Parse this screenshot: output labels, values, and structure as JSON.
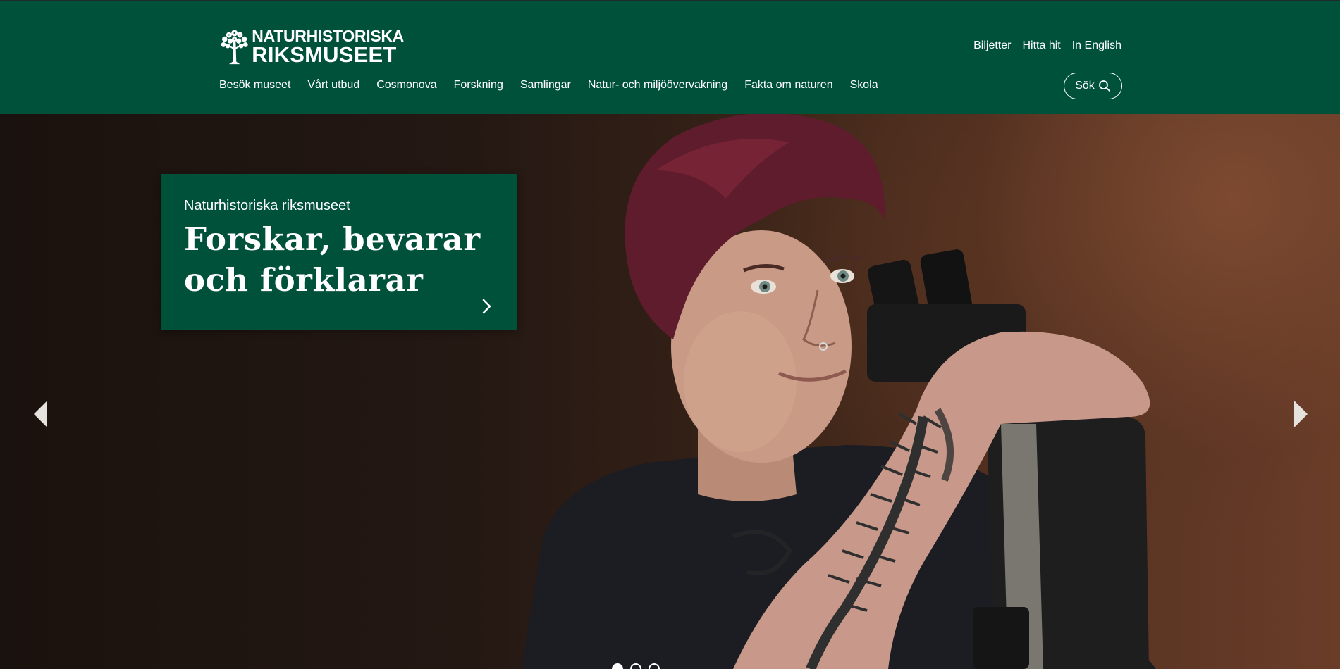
{
  "brand": {
    "line1": "NATURHISTORISKA",
    "line2": "RIKSMUSEET",
    "accent_color": "#00513a"
  },
  "top_links": [
    "Biljetter",
    "Hitta hit",
    "In English"
  ],
  "main_nav": [
    "Besök museet",
    "Vårt utbud",
    "Cosmonova",
    "Forskning",
    "Samlingar",
    "Natur- och miljöövervakning",
    "Fakta om naturen",
    "Skola"
  ],
  "search": {
    "label": "Sök",
    "icon": "search-icon"
  },
  "hero": {
    "kicker": "Naturhistoriska riksmuseet",
    "title": "Forskar, bevarar och förklarar",
    "card_icon": "chevron-right-icon",
    "prev_icon": "triangle-left-icon",
    "next_icon": "triangle-right-icon"
  },
  "slider": {
    "slide_count": 3,
    "active_index": 0
  }
}
